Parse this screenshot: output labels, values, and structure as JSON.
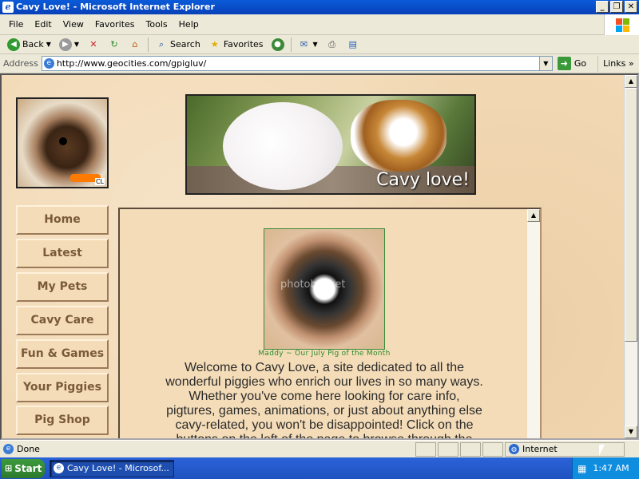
{
  "window": {
    "title": "Cavy Love! - Microsoft Internet Explorer",
    "buttons": [
      "_",
      "❐",
      "✕"
    ]
  },
  "menu": [
    "File",
    "Edit",
    "View",
    "Favorites",
    "Tools",
    "Help"
  ],
  "toolbar": {
    "back": "Back",
    "search": "Search",
    "favorites": "Favorites"
  },
  "address": {
    "label": "Address",
    "url": "http://www.geocities.com/gpigluv/",
    "go": "Go",
    "links": "Links"
  },
  "page": {
    "banner_text": "Cavy love!",
    "logo_tag": "CL",
    "nav": [
      "Home",
      "Latest",
      "My Pets",
      "Cavy Care",
      "Fun & Games",
      "Your Piggies",
      "Pig Shop"
    ],
    "photo_watermark": "photobucket",
    "caption": "Maddy ~ Our July Pig of the Month",
    "welcome": "Welcome to Cavy Love, a site dedicated to all the wonderful piggies who enrich our lives in so many ways. Whether you've come here looking for care info, pigtures, games, animations, or just about anything else cavy-related, you won't be disappointed! Click on the buttons on the left of the page to browse through the site, and be"
  },
  "status": {
    "text": "Done",
    "zone": "Internet"
  },
  "taskbar": {
    "start": "Start",
    "task": "Cavy Love! - Microsof...",
    "clock": "1:47 AM"
  }
}
